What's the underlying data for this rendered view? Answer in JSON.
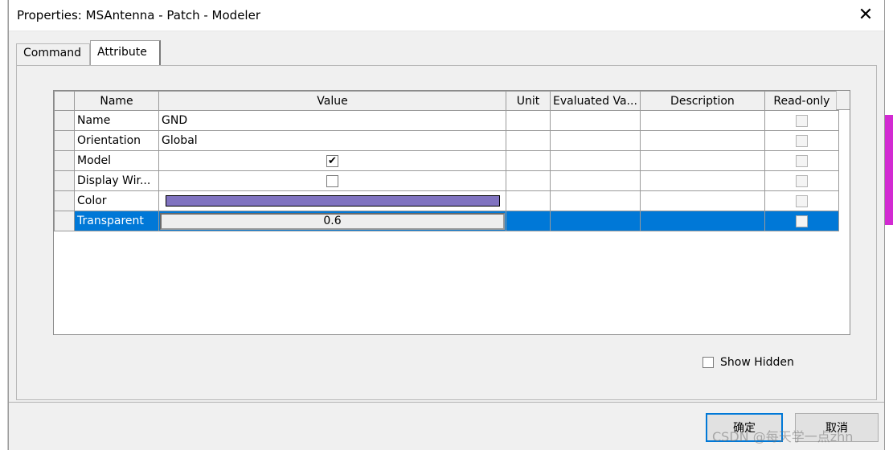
{
  "window": {
    "title": "Properties: MSAntenna - Patch - Modeler",
    "close_glyph": "✕"
  },
  "tabs": [
    {
      "label": "Command",
      "active": false
    },
    {
      "label": "Attribute",
      "active": true
    }
  ],
  "table": {
    "columns": [
      "Name",
      "Value",
      "Unit",
      "Evaluated Va...",
      "Description",
      "Read-only"
    ],
    "rows": [
      {
        "name": "Name",
        "value": "GND",
        "type": "text",
        "read_only": false
      },
      {
        "name": "Orientation",
        "value": "Global",
        "type": "text",
        "read_only": false
      },
      {
        "name": "Model",
        "value": true,
        "type": "checkbox",
        "read_only": false
      },
      {
        "name": "Display Wir...",
        "value": false,
        "type": "checkbox",
        "read_only": false
      },
      {
        "name": "Color",
        "value": "#8073c0",
        "type": "color",
        "read_only": false
      },
      {
        "name": "Transparent",
        "value": "0.6",
        "type": "edit",
        "read_only": false,
        "selected": true
      }
    ]
  },
  "options": {
    "show_hidden_label": "Show Hidden",
    "show_hidden_checked": false
  },
  "buttons": {
    "ok_label": "确定",
    "cancel_label": "取消"
  },
  "watermark": "CSDN @每天学一点zhn",
  "colors": {
    "selection": "#0078d7",
    "accent_magenta": "#d22ad2",
    "color_swatch": "#8073c0"
  },
  "icons": {
    "check": "✔"
  }
}
